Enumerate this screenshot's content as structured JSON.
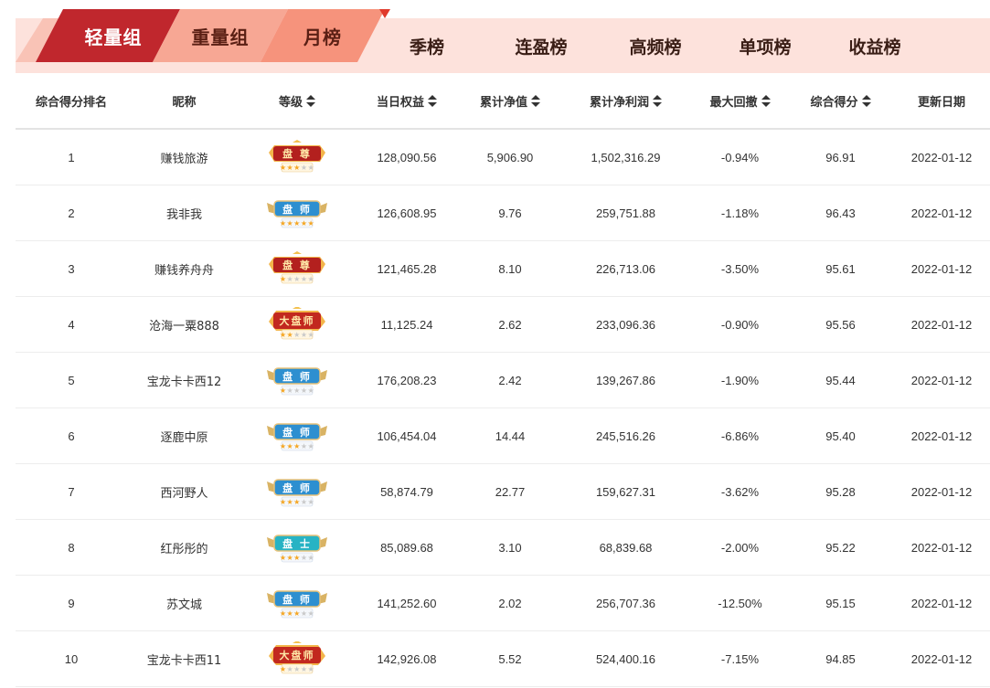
{
  "tabs": {
    "primary": [
      {
        "label": "轻量组",
        "active": true
      },
      {
        "label": "重量组",
        "active": false
      },
      {
        "label": "月榜",
        "active": false
      }
    ],
    "secondary": [
      "季榜",
      "连盈榜",
      "高频榜",
      "单项榜",
      "收益榜"
    ]
  },
  "colors": {
    "active_tab": "#c0272d",
    "inactive_tab": "#f5a08e",
    "tab_bar_bg": "#fde2dc",
    "accent_triangle": "#e03a2c"
  },
  "table": {
    "headers": {
      "rank": "综合得分排名",
      "name": "昵称",
      "level": "等级",
      "equity": "当日权益",
      "nav": "累计净值",
      "profit": "累计净利润",
      "drawdown": "最大回撤",
      "score": "综合得分",
      "date": "更新日期"
    },
    "rows": [
      {
        "rank": "1",
        "name": "赚钱旅游",
        "level": {
          "type": "zun",
          "label": "盘 尊",
          "stars": 3
        },
        "equity": "128,090.56",
        "nav": "5,906.90",
        "profit": "1,502,316.29",
        "drawdown": "-0.94%",
        "score": "96.91",
        "date": "2022-01-12"
      },
      {
        "rank": "2",
        "name": "我非我",
        "level": {
          "type": "shi",
          "label": "盘 师",
          "stars": 5
        },
        "equity": "126,608.95",
        "nav": "9.76",
        "profit": "259,751.88",
        "drawdown": "-1.18%",
        "score": "96.43",
        "date": "2022-01-12"
      },
      {
        "rank": "3",
        "name": "赚钱养舟舟",
        "level": {
          "type": "zun",
          "label": "盘 尊",
          "stars": 1
        },
        "equity": "121,465.28",
        "nav": "8.10",
        "profit": "226,713.06",
        "drawdown": "-3.50%",
        "score": "95.61",
        "date": "2022-01-12"
      },
      {
        "rank": "4",
        "name": "沧海一粟888",
        "level": {
          "type": "dsh",
          "label": "大盘师",
          "stars": 2
        },
        "equity": "11,125.24",
        "nav": "2.62",
        "profit": "233,096.36",
        "drawdown": "-0.90%",
        "score": "95.56",
        "date": "2022-01-12"
      },
      {
        "rank": "5",
        "name": "宝龙卡卡西12",
        "level": {
          "type": "shi",
          "label": "盘 师",
          "stars": 1
        },
        "equity": "176,208.23",
        "nav": "2.42",
        "profit": "139,267.86",
        "drawdown": "-1.90%",
        "score": "95.44",
        "date": "2022-01-12"
      },
      {
        "rank": "6",
        "name": "逐鹿中原",
        "level": {
          "type": "shi",
          "label": "盘 师",
          "stars": 3
        },
        "equity": "106,454.04",
        "nav": "14.44",
        "profit": "245,516.26",
        "drawdown": "-6.86%",
        "score": "95.40",
        "date": "2022-01-12"
      },
      {
        "rank": "7",
        "name": "西河野人",
        "level": {
          "type": "shi",
          "label": "盘 师",
          "stars": 3
        },
        "equity": "58,874.79",
        "nav": "22.77",
        "profit": "159,627.31",
        "drawdown": "-3.62%",
        "score": "95.28",
        "date": "2022-01-12"
      },
      {
        "rank": "8",
        "name": "红彤彤的",
        "level": {
          "type": "shi2",
          "label": "盘 士",
          "stars": 3
        },
        "equity": "85,089.68",
        "nav": "3.10",
        "profit": "68,839.68",
        "drawdown": "-2.00%",
        "score": "95.22",
        "date": "2022-01-12"
      },
      {
        "rank": "9",
        "name": "苏文城",
        "level": {
          "type": "shi",
          "label": "盘 师",
          "stars": 3
        },
        "equity": "141,252.60",
        "nav": "2.02",
        "profit": "256,707.36",
        "drawdown": "-12.50%",
        "score": "95.15",
        "date": "2022-01-12"
      },
      {
        "rank": "10",
        "name": "宝龙卡卡西11",
        "level": {
          "type": "dsh",
          "label": "大盘师",
          "stars": 1
        },
        "equity": "142,926.08",
        "nav": "5.52",
        "profit": "524,400.16",
        "drawdown": "-7.15%",
        "score": "94.85",
        "date": "2022-01-12"
      }
    ]
  }
}
